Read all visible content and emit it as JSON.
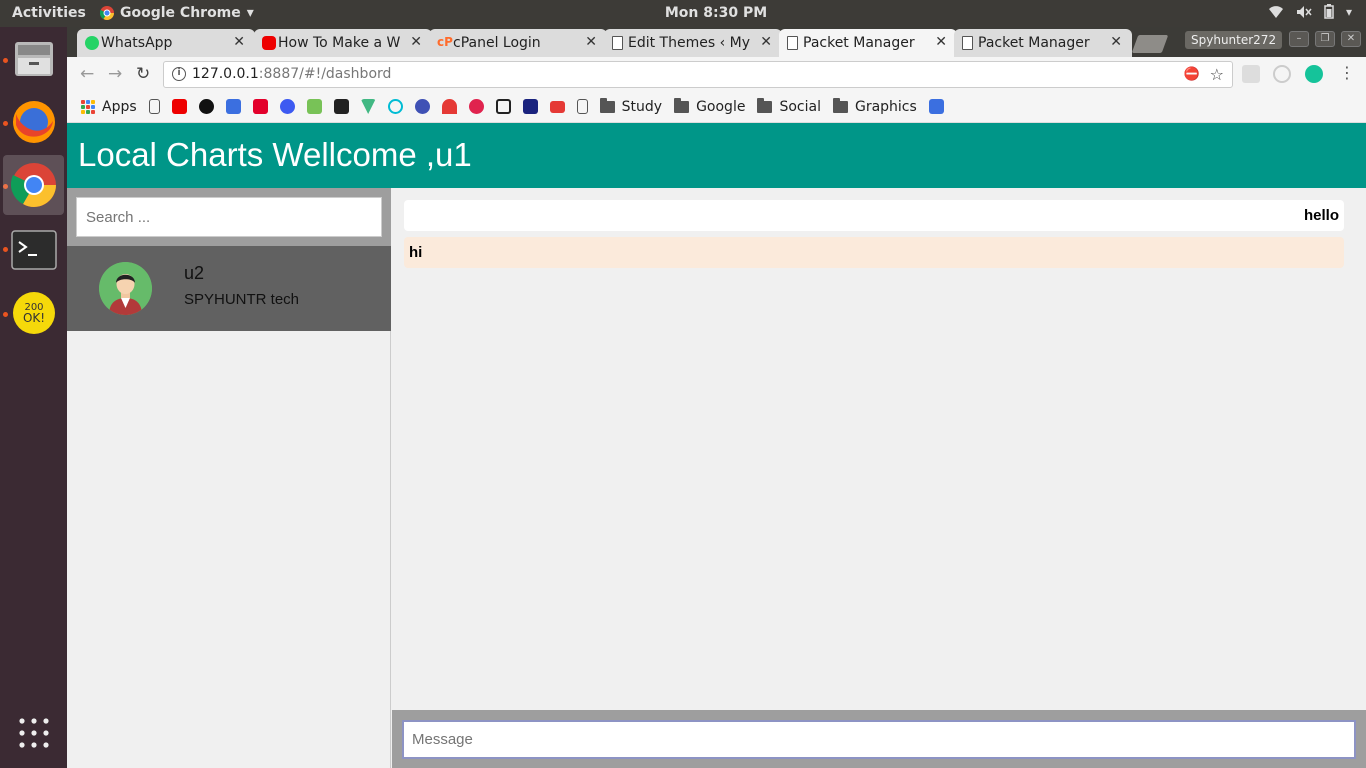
{
  "topbar": {
    "activities": "Activities",
    "app_name": "Google Chrome",
    "clock": "Mon  8:30 PM"
  },
  "dock": {
    "items": [
      "files",
      "firefox",
      "chrome",
      "terminal",
      "http-status-app",
      "show-applications"
    ]
  },
  "browser": {
    "tabs": [
      {
        "title": "WhatsApp",
        "icon": "whatsapp-icon"
      },
      {
        "title": "How To Make a W",
        "icon": "youtube-icon"
      },
      {
        "title": "cPanel Login",
        "icon": "cpanel-icon"
      },
      {
        "title": "Edit Themes ‹ My",
        "icon": "page-icon"
      },
      {
        "title": "Packet Manager",
        "icon": "page-icon",
        "active": true
      },
      {
        "title": "Packet Manager",
        "icon": "page-icon"
      }
    ],
    "profile": "Spyhunter272",
    "url_host": "127.0.0.1",
    "url_path": ":8887/#!/dashbord",
    "bookmarks": {
      "apps": "Apps",
      "folders": [
        "Study",
        "Google",
        "Social",
        "Graphics"
      ]
    }
  },
  "app": {
    "header_title": "Local Charts Wellcome ,u1",
    "search_placeholder": "Search ...",
    "contact": {
      "name": "u2",
      "status": "SPYHUNTR tech"
    },
    "messages": [
      {
        "text": "hello",
        "side": "sent"
      },
      {
        "text": "hi",
        "side": "received"
      }
    ],
    "message_placeholder": "Message"
  },
  "colors": {
    "header": "#009688",
    "contact_bg": "#616161",
    "received_bubble": "#fbeadb"
  }
}
